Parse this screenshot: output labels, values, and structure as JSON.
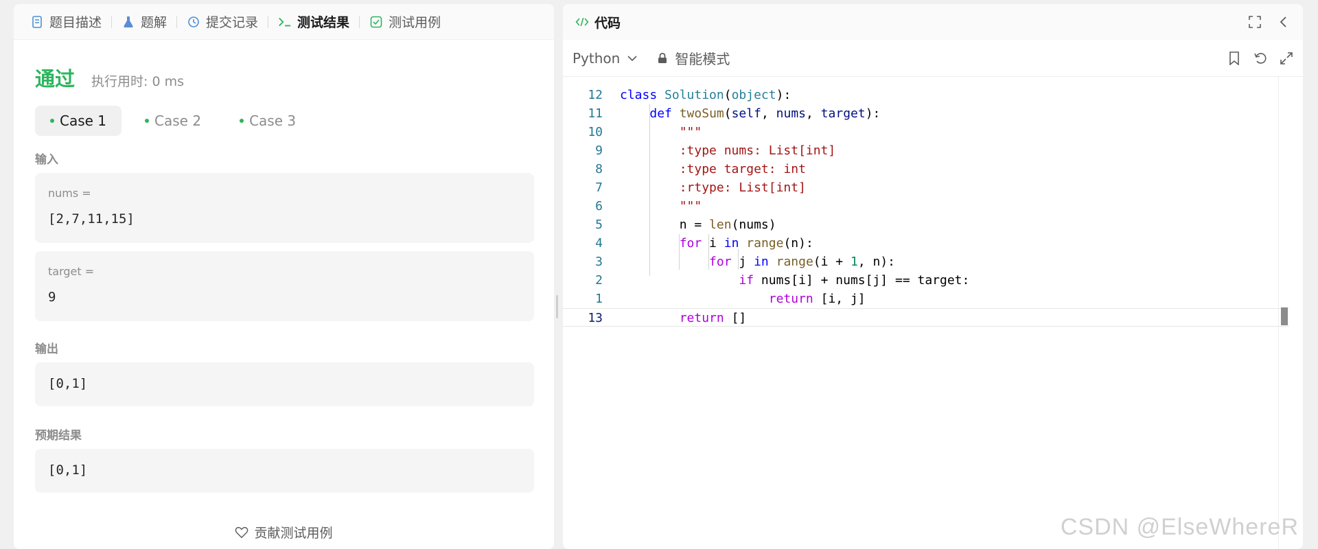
{
  "left_panel": {
    "tabs": [
      {
        "label": "题目描述",
        "icon": "document-icon"
      },
      {
        "label": "题解",
        "icon": "flask-icon"
      },
      {
        "label": "提交记录",
        "icon": "history-icon"
      },
      {
        "label": "测试结果",
        "icon": "terminal-icon"
      },
      {
        "label": "测试用例",
        "icon": "checkbox-icon"
      }
    ],
    "active_tab": "测试结果",
    "status": "通过",
    "runtime": "执行用时: 0 ms",
    "cases": [
      "Case 1",
      "Case 2",
      "Case 3"
    ],
    "active_case": "Case 1",
    "input_label": "输入",
    "inputs": [
      {
        "name": "nums =",
        "value": "[2,7,11,15]"
      },
      {
        "name": "target =",
        "value": "9"
      }
    ],
    "output_label": "输出",
    "output_value": "[0,1]",
    "expected_label": "预期结果",
    "expected_value": "[0,1]",
    "contribute_label": "贡献测试用例"
  },
  "right_panel": {
    "title": "代码",
    "language": "Python",
    "mode": "智能模式",
    "code_lines": [
      {
        "no": "12",
        "text": "class Solution(object):"
      },
      {
        "no": "11",
        "text": "    def twoSum(self, nums, target):"
      },
      {
        "no": "10",
        "text": "        \"\"\""
      },
      {
        "no": "9",
        "text": "        :type nums: List[int]"
      },
      {
        "no": "8",
        "text": "        :type target: int"
      },
      {
        "no": "7",
        "text": "        :rtype: List[int]"
      },
      {
        "no": "6",
        "text": "        \"\"\""
      },
      {
        "no": "5",
        "text": "        n = len(nums)"
      },
      {
        "no": "4",
        "text": "        for i in range(n):"
      },
      {
        "no": "3",
        "text": "            for j in range(i + 1, n):"
      },
      {
        "no": "2",
        "text": "                if nums[i] + nums[j] == target:"
      },
      {
        "no": "1",
        "text": "                    return [i, j]"
      },
      {
        "no": "13",
        "text": "        return []"
      }
    ]
  },
  "watermark": "CSDN @ElseWhereR",
  "colors": {
    "success": "#2db55d",
    "keyword": "#0000ff",
    "control": "#af00db",
    "class": "#267f99",
    "string": "#a31515",
    "number": "#098658"
  }
}
